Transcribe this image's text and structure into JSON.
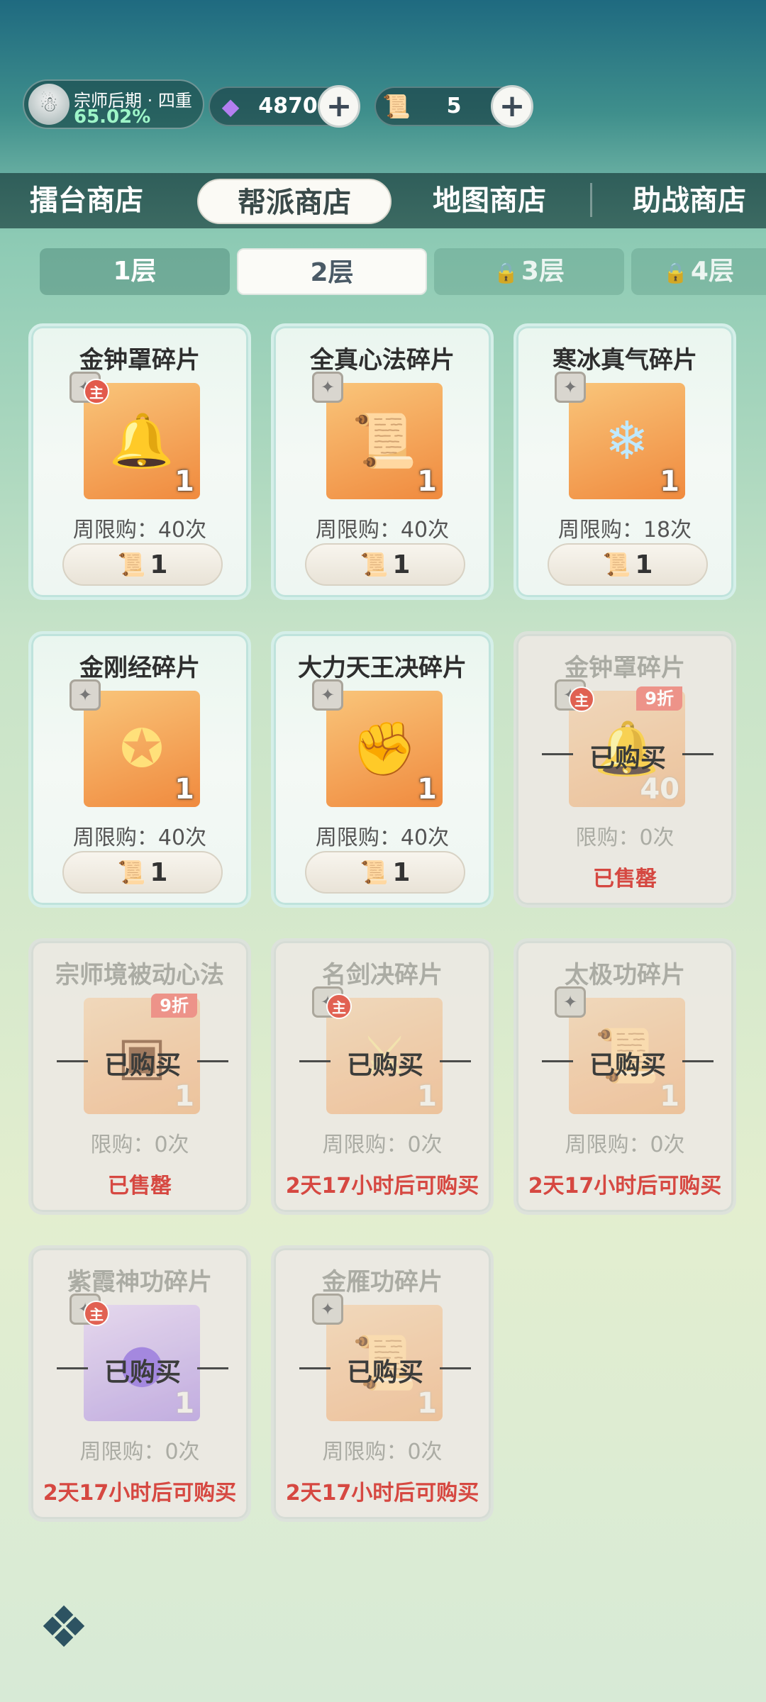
{
  "player": {
    "rank": "宗师后期 · 四重",
    "progress": "65.02%"
  },
  "currencies": [
    {
      "icon": "gem-icon",
      "value": "4870"
    },
    {
      "icon": "scroll-icon",
      "value": "5"
    }
  ],
  "shop_tabs": [
    "擂台商店",
    "帮派商店",
    "地图商店",
    "助战商店"
  ],
  "active_shop_tab": "帮派商店",
  "floor_tabs": [
    {
      "label": "1层",
      "locked": false
    },
    {
      "label": "2层",
      "locked": false
    },
    {
      "label": "3层",
      "locked": true
    },
    {
      "label": "4层",
      "locked": true
    }
  ],
  "active_floor": "2层",
  "items": [
    {
      "name": "金钟罩碎片",
      "count": "1",
      "limit": "周限购：40次",
      "price": "1",
      "main": true,
      "sold": false
    },
    {
      "name": "全真心法碎片",
      "count": "1",
      "limit": "周限购：40次",
      "price": "1",
      "main": false,
      "sold": false
    },
    {
      "name": "寒冰真气碎片",
      "count": "1",
      "limit": "周限购：18次",
      "price": "1",
      "main": false,
      "sold": false
    },
    {
      "name": "金刚经碎片",
      "count": "1",
      "limit": "周限购：40次",
      "price": "1",
      "main": false,
      "sold": false
    },
    {
      "name": "大力天王决碎片",
      "count": "1",
      "limit": "周限购：40次",
      "price": "1",
      "main": false,
      "sold": false
    },
    {
      "name": "金钟罩碎片",
      "count": "40",
      "limit": "限购：0次",
      "bought": "已购买",
      "status": "已售罄",
      "discount": "9折",
      "main": true,
      "sold": true
    },
    {
      "name": "宗师境被动心法",
      "count": "1",
      "limit": "限购：0次",
      "bought": "已购买",
      "status": "已售罄",
      "discount": "9折",
      "main": false,
      "sold": true
    },
    {
      "name": "名剑决碎片",
      "count": "1",
      "limit": "周限购：0次",
      "bought": "已购买",
      "status": "2天17小时后可购买",
      "main": true,
      "sold": true
    },
    {
      "name": "太极功碎片",
      "count": "1",
      "limit": "周限购：0次",
      "bought": "已购买",
      "status": "2天17小时后可购买",
      "main": false,
      "sold": true
    },
    {
      "name": "紫霞神功碎片",
      "count": "1",
      "limit": "周限购：0次",
      "bought": "已购买",
      "status": "2天17小时后可购买",
      "main": true,
      "sold": true
    },
    {
      "name": "金雁功碎片",
      "count": "1",
      "limit": "周限购：0次",
      "bought": "已购买",
      "status": "2天17小时后可购买",
      "main": false,
      "sold": true
    }
  ],
  "main_badge": "主",
  "colors": {
    "accent_red": "#d6403a",
    "item_bg": "#f08a3e",
    "tab_bar": "#2f5e5a"
  }
}
